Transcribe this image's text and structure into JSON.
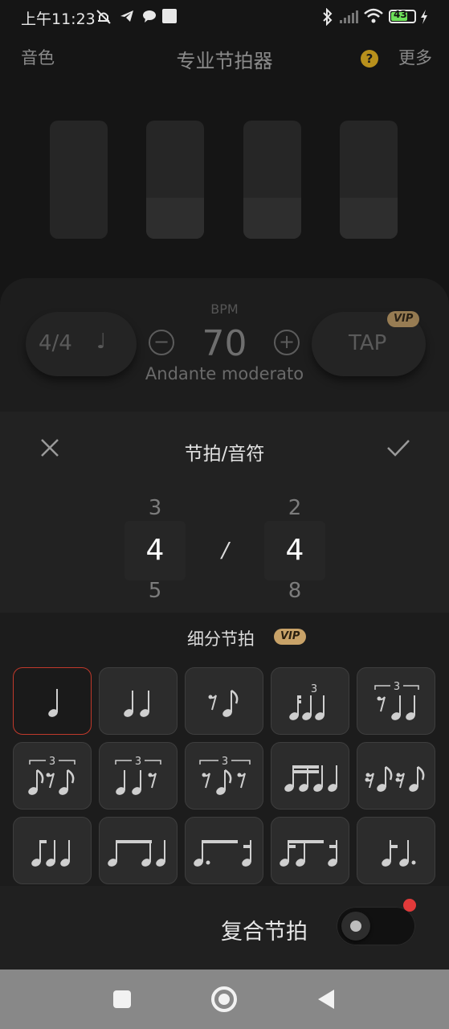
{
  "status_bar": {
    "time": "上午11:23",
    "battery": "43"
  },
  "header": {
    "left": "音色",
    "title": "专业节拍器",
    "help_glyph": "?",
    "right": "更多"
  },
  "beat_levels": [
    0.0,
    0.35,
    0.35,
    0.35
  ],
  "controls": {
    "time_signature": "4/4",
    "note_glyph": "♩",
    "bpm_label": "BPM",
    "bpm": "70",
    "tempo_name": "Andante moderato",
    "minus": "−",
    "plus": "+",
    "tap": "TAP",
    "vip": "VIP"
  },
  "sheet": {
    "title": "节拍/音符",
    "beats_picker": {
      "above": "3",
      "selected": "4",
      "below": "5"
    },
    "separator": "/",
    "note_picker": {
      "above": "2",
      "selected": "4",
      "below": "8"
    }
  },
  "subdivision": {
    "title": "细分节拍",
    "vip": "VIP",
    "items": [
      {
        "icon": "quarter-note-icon",
        "selected": true
      },
      {
        "icon": "two-eighths-icon",
        "selected": false
      },
      {
        "icon": "rest-eighth-icon",
        "selected": false
      },
      {
        "icon": "sixteenth-triplet-icon",
        "selected": false
      },
      {
        "icon": "rest-triplet-icon",
        "selected": false
      },
      {
        "icon": "triplet-mid-rest-icon",
        "selected": false
      },
      {
        "icon": "triplet-end-rest-icon",
        "selected": false
      },
      {
        "icon": "triplet-outer-rest-icon",
        "selected": false
      },
      {
        "icon": "four-sixteenths-icon",
        "selected": false
      },
      {
        "icon": "syncopated-rest-icon",
        "selected": false
      },
      {
        "icon": "sixteenth-group-icon",
        "selected": false
      },
      {
        "icon": "eighth-two-sixteenths-icon",
        "selected": false
      },
      {
        "icon": "dotted-eighth-sixteenth-icon",
        "selected": false
      },
      {
        "icon": "sixteenth-eighth-sixteenth-icon",
        "selected": false
      },
      {
        "icon": "sixteenth-dotted-eighth-icon",
        "selected": false
      }
    ]
  },
  "footer": {
    "compound_label": "复合节拍",
    "compound_on": false
  },
  "colors": {
    "accent_vip": "#c8a268",
    "selected_border": "#c0392b",
    "help": "#b8901c"
  },
  "triplet_digit": "3"
}
